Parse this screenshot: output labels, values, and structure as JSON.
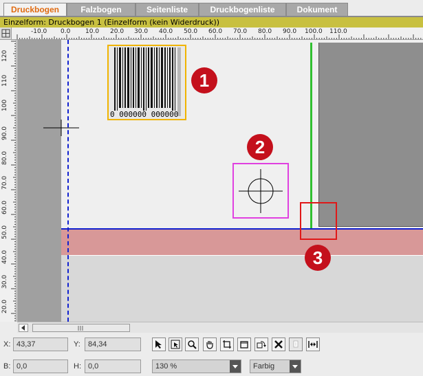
{
  "tabs": [
    {
      "label": "Druckbogen",
      "active": true
    },
    {
      "label": "Falzbogen",
      "active": false
    },
    {
      "label": "Seitenliste",
      "active": false
    },
    {
      "label": "Druckbogenliste",
      "active": false
    },
    {
      "label": "Dokument",
      "active": false
    }
  ],
  "info_bar": "Einzelform:  Druckbogen 1 (Einzelform (kein Widerdruck))",
  "hruler_labels": [
    "-10.0",
    "0.0",
    "10.0",
    "20.0",
    "30.0",
    "40.0",
    "50.0",
    "60.0",
    "70.0",
    "80.0",
    "90.0",
    "100.0",
    "110.0"
  ],
  "vruler_labels": [
    "120",
    "110",
    "100",
    "90.0",
    "80.0",
    "70.0",
    "60.0",
    "50.0",
    "40.0",
    "30.0",
    "20.0"
  ],
  "canvas": {
    "barcode_text": "0 000000 000000",
    "callouts": [
      "1",
      "2",
      "3"
    ],
    "colors": {
      "barcode_frame": "#f0b400",
      "mark_frame": "#e040e0",
      "highlight_frame": "#e01818",
      "guide_green": "#30c030",
      "guide_blue": "#1020d0",
      "bleed_band": "#d89898",
      "callout": "#c4101c"
    }
  },
  "toolbar": {
    "x_label": "X:",
    "x_value": "43,37",
    "y_label": "Y:",
    "y_value": "84,34",
    "b_label": "B:",
    "b_value": "0,0",
    "h_label": "H:",
    "h_value": "0,0",
    "zoom_value": "130 %",
    "color_mode_value": "Farbig",
    "tools": [
      "pointer-icon",
      "select-frame-icon",
      "zoom-icon",
      "hand-icon",
      "crop-icon",
      "frame-icon",
      "rotate-icon",
      "delete-icon",
      "bucket-icon",
      "distribute-icon"
    ]
  }
}
